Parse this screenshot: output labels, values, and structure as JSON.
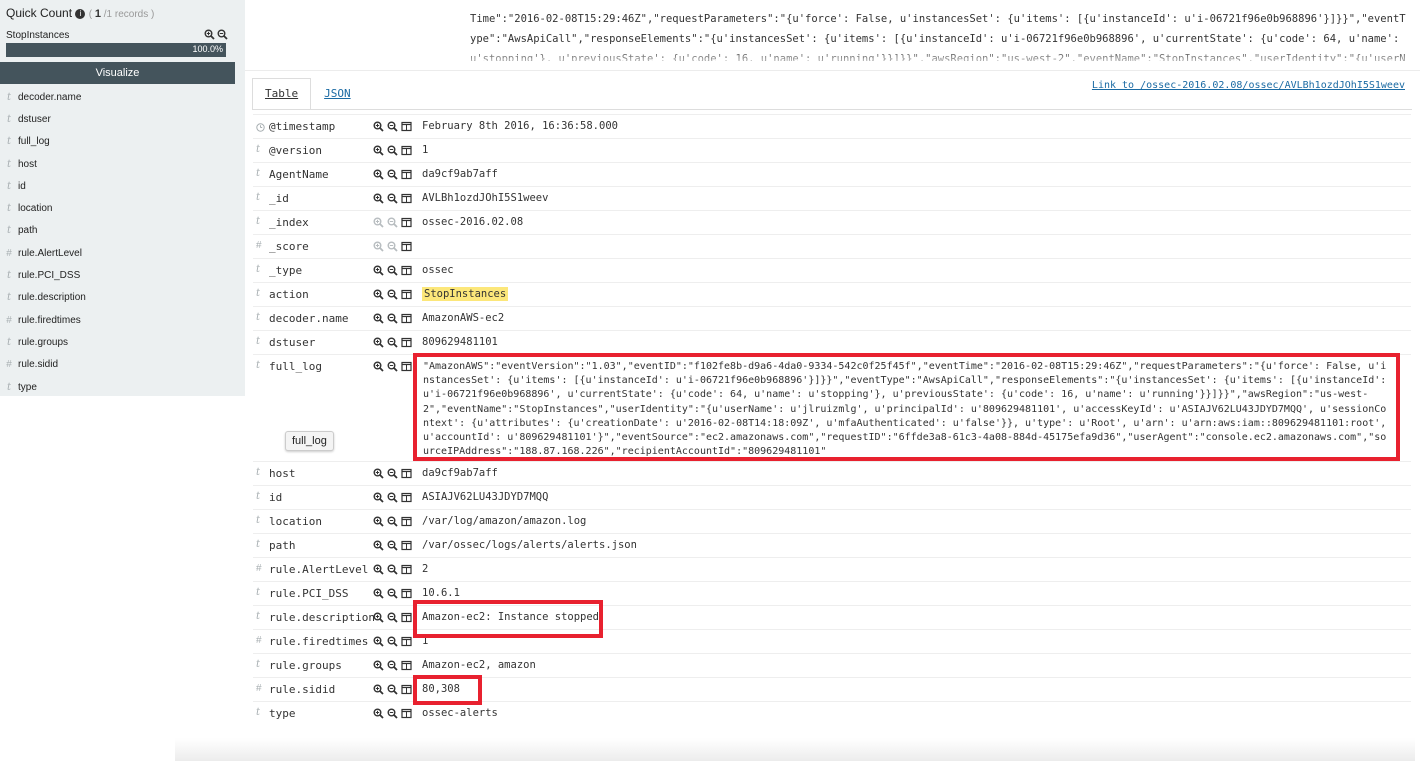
{
  "quick_count": {
    "title": "Quick Count",
    "count": "1",
    "records_text": "/1 records )",
    "open_paren": "(",
    "value": "StopInstances",
    "percent": "100.0%",
    "percent_value": 1.0,
    "visualize_label": "Visualize"
  },
  "sidebar": {
    "fields": [
      {
        "type": "t",
        "name": "decoder.name"
      },
      {
        "type": "t",
        "name": "dstuser"
      },
      {
        "type": "t",
        "name": "full_log"
      },
      {
        "type": "t",
        "name": "host"
      },
      {
        "type": "t",
        "name": "id"
      },
      {
        "type": "t",
        "name": "location"
      },
      {
        "type": "t",
        "name": "path"
      },
      {
        "type": "#",
        "name": "rule.AlertLevel"
      },
      {
        "type": "t",
        "name": "rule.PCI_DSS"
      },
      {
        "type": "t",
        "name": "rule.description"
      },
      {
        "type": "#",
        "name": "rule.firedtimes"
      },
      {
        "type": "t",
        "name": "rule.groups"
      },
      {
        "type": "#",
        "name": "rule.sidid"
      },
      {
        "type": "t",
        "name": "type"
      }
    ]
  },
  "top_log": "Time\":\"2016-02-08T15:29:46Z\",\"requestParameters\":\"{u'force': False, u'instancesSet': {u'items': [{u'instanceId': u'i-06721f96e0b968896'}]}}\",\"eventType\":\"AwsApiCall\",\"responseElements\":\"{u'instancesSet': {u'items': [{u'instanceId': u'i-06721f96e0b968896', u'currentState': {u'code': 64, u'name': u'stopping'}, u'previousState': {u'code': 16, u'name': u'running'}}]}}\",\"awsRegion\":\"us-west-2\",\"eventName\":\"StopInstances\",\"userIdentity\":\"{u'userName': u'jlruizmlg', u",
  "tabs": {
    "table": "Table",
    "json": "JSON"
  },
  "doc_link": "Link to /ossec-2016.02.08/ossec/AVLBh1ozdJOhI5S1weev",
  "rows": [
    {
      "type": "clock",
      "name": "@timestamp",
      "value": "February 8th 2016, 16:36:58.000"
    },
    {
      "type": "t",
      "name": "@version",
      "value": "1"
    },
    {
      "type": "t",
      "name": "AgentName",
      "value": "da9cf9ab7aff"
    },
    {
      "type": "t",
      "name": "_id",
      "value": "AVLBh1ozdJOhI5S1weev"
    },
    {
      "type": "t",
      "name": "_index",
      "value": "ossec-2016.02.08"
    },
    {
      "type": "#",
      "name": "_score",
      "value": ""
    },
    {
      "type": "t",
      "name": "_type",
      "value": "ossec"
    },
    {
      "type": "t",
      "name": "action",
      "value": "StopInstances"
    },
    {
      "type": "t",
      "name": "decoder.name",
      "value": "AmazonAWS-ec2"
    },
    {
      "type": "t",
      "name": "dstuser",
      "value": "809629481101"
    },
    {
      "type": "t",
      "name": "full_log",
      "value": "\"AmazonAWS\":\"eventVersion\":\"1.03\",\"eventID\":\"f102fe8b-d9a6-4da0-9334-542c0f25f45f\",\"eventTime\":\"2016-02-08T15:29:46Z\",\"requestParameters\":\"{u'force': False, u'instancesSet': {u'items': [{u'instanceId': u'i-06721f96e0b968896'}]}}\",\"eventType\":\"AwsApiCall\",\"responseElements\":\"{u'instancesSet': {u'items': [{u'instanceId': u'i-06721f96e0b968896', u'currentState': {u'code': 64, u'name': u'stopping'}, u'previousState': {u'code': 16, u'name': u'running'}}]}}\",\"awsRegion\":\"us-west-2\",\"eventName\":\"StopInstances\",\"userIdentity\":\"{u'userName': u'jlruizmlg', u'principalId': u'809629481101', u'accessKeyId': u'ASIAJV62LU43JDYD7MQQ', u'sessionContext': {u'attributes': {u'creationDate': u'2016-02-08T14:18:09Z', u'mfaAuthenticated': u'false'}}, u'type': u'Root', u'arn': u'arn:aws:iam::809629481101:root', u'accountId': u'809629481101'}\",\"eventSource\":\"ec2.amazonaws.com\",\"requestID\":\"6ffde3a8-61c3-4a08-884d-45175efa9d36\",\"userAgent\":\"console.ec2.amazonaws.com\",\"sourceIPAddress\":\"188.87.168.226\",\"recipientAccountId\":\"809629481101\"",
      "tooltip": "full_log"
    },
    {
      "type": "t",
      "name": "host",
      "value": "da9cf9ab7aff"
    },
    {
      "type": "t",
      "name": "id",
      "value": "ASIAJV62LU43JDYD7MQQ"
    },
    {
      "type": "t",
      "name": "location",
      "value": "/var/log/amazon/amazon.log"
    },
    {
      "type": "t",
      "name": "path",
      "value": "/var/ossec/logs/alerts/alerts.json"
    },
    {
      "type": "#",
      "name": "rule.AlertLevel",
      "value": "2"
    },
    {
      "type": "t",
      "name": "rule.PCI_DSS",
      "value": "10.6.1"
    },
    {
      "type": "t",
      "name": "rule.description",
      "value": "Amazon-ec2: Instance stopped"
    },
    {
      "type": "#",
      "name": "rule.firedtimes",
      "value": "1"
    },
    {
      "type": "t",
      "name": "rule.groups",
      "value": "Amazon-ec2, amazon"
    },
    {
      "type": "#",
      "name": "rule.sidid",
      "value": "80,308"
    },
    {
      "type": "t",
      "name": "type",
      "value": "ossec-alerts"
    }
  ],
  "colors": {
    "highlight_box": "#e8212f",
    "term_highlight": "#fce77a",
    "sidebar_bg": "#ecf0f1",
    "button_bg": "#44545c",
    "link": "#1a6aa3"
  }
}
